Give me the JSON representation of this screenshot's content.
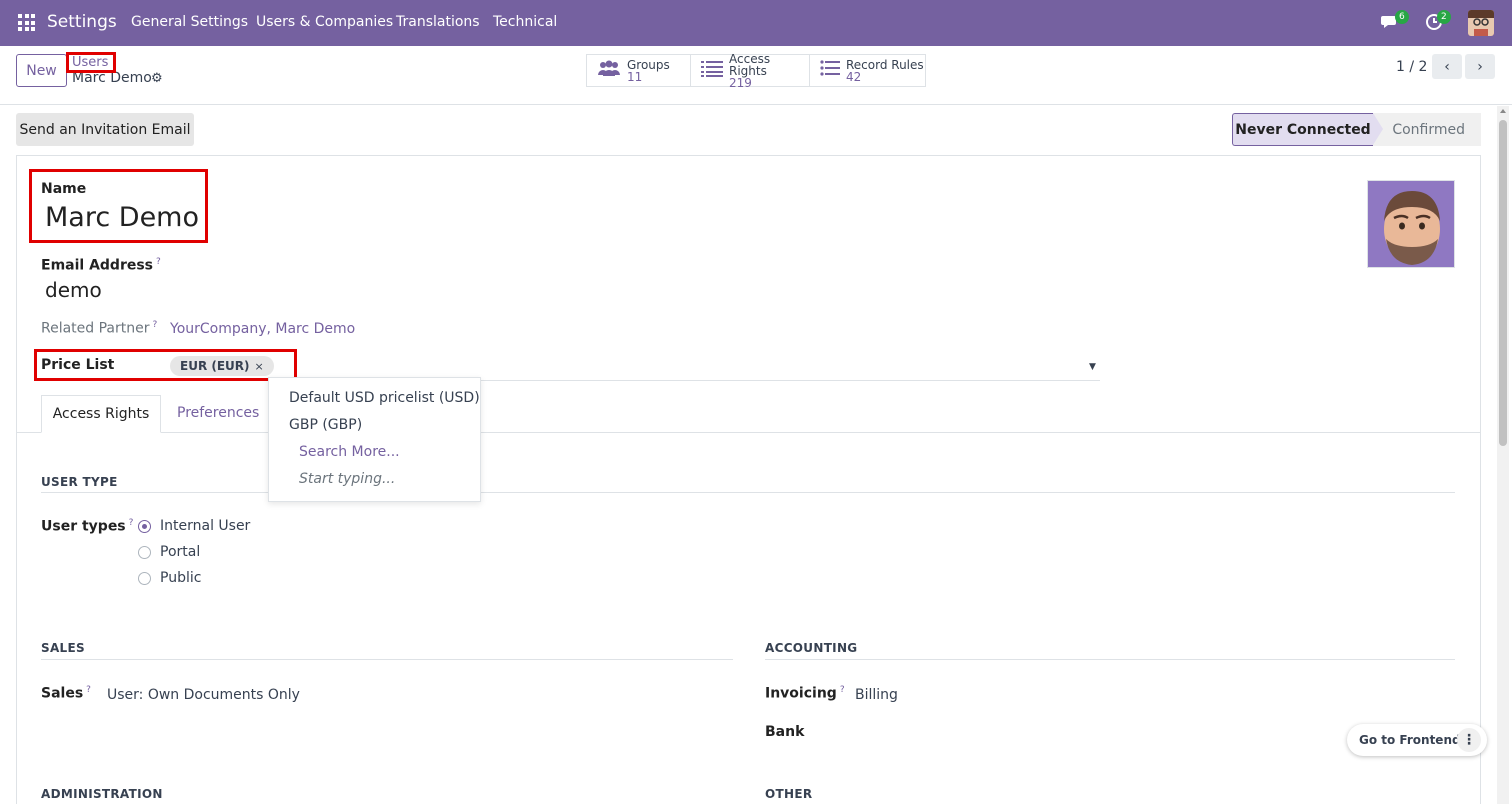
{
  "navbar": {
    "brand": "Settings",
    "menus": [
      "General Settings",
      "Users & Companies",
      "Translations",
      "Technical"
    ],
    "messages_count": "6",
    "activities_count": "2"
  },
  "control_panel": {
    "new_label": "New",
    "breadcrumb_parent": "Users",
    "breadcrumb_current": "Marc Demo",
    "smart_buttons": [
      {
        "label": "Groups",
        "count": "11",
        "icon": "users-icon"
      },
      {
        "label": "Access Rights",
        "count": "219",
        "icon": "list-icon"
      },
      {
        "label": "Record Rules",
        "count": "42",
        "icon": "list-icon"
      }
    ],
    "pager": "1 / 2"
  },
  "statusbar": {
    "invite_label": "Send an Invitation Email",
    "states": [
      "Never Connected",
      "Confirmed"
    ],
    "active_state": "Never Connected"
  },
  "form": {
    "name_label": "Name",
    "name_value": "Marc Demo",
    "email_label": "Email Address",
    "email_value": "demo",
    "partner_label": "Related Partner",
    "partner_value": "YourCompany, Marc Demo",
    "pricelist_label": "Price List",
    "pricelist_tag": "EUR (EUR)",
    "help_mark": "?",
    "tag_remove": "×"
  },
  "dropdown": {
    "options": [
      "Default USD pricelist (USD)",
      "GBP (GBP)"
    ],
    "search_more": "Search More...",
    "start_typing": "Start typing..."
  },
  "tabs": [
    "Access Rights",
    "Preferences"
  ],
  "sections": {
    "user_type": {
      "title": "USER TYPE",
      "label": "User types",
      "options": [
        "Internal User",
        "Portal",
        "Public"
      ],
      "selected": "Internal User"
    },
    "sales": {
      "title": "SALES",
      "label": "Sales",
      "value": "User: Own Documents Only"
    },
    "accounting": {
      "title": "ACCOUNTING",
      "invoicing_label": "Invoicing",
      "invoicing_value": "Billing",
      "bank_label": "Bank"
    },
    "administration": {
      "title": "ADMINISTRATION"
    },
    "other": {
      "title": "OTHER"
    }
  },
  "frontend": {
    "label": "Go to Frontend",
    "menu": "⋮"
  },
  "colors": {
    "brand": "#7561a0",
    "highlight": "#e00000"
  }
}
